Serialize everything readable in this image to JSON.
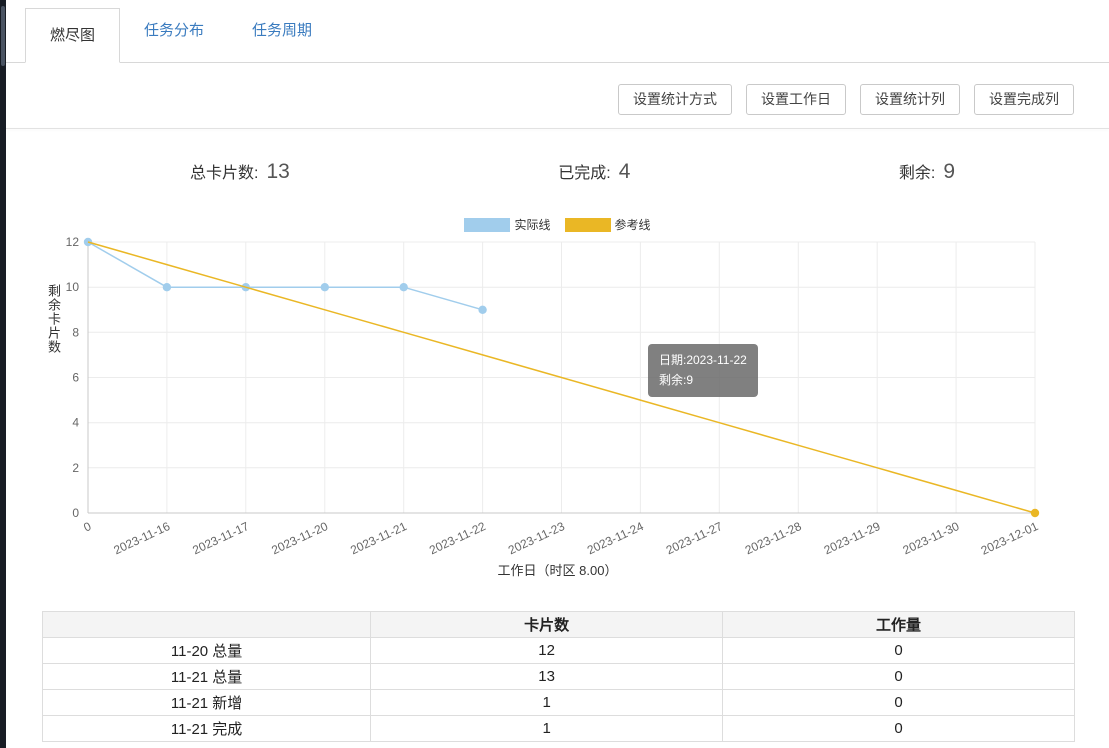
{
  "tabs": [
    {
      "label": "燃尽图",
      "active": true
    },
    {
      "label": "任务分布",
      "active": false
    },
    {
      "label": "任务周期",
      "active": false
    }
  ],
  "toolbar": {
    "buttons": [
      "设置统计方式",
      "设置工作日",
      "设置统计列",
      "设置完成列"
    ]
  },
  "stats": [
    {
      "label": "总卡片数:",
      "value": "13"
    },
    {
      "label": "已完成:",
      "value": "4"
    },
    {
      "label": "剩余:",
      "value": "9"
    }
  ],
  "chart_data": {
    "type": "line",
    "title": "燃尽图",
    "x": [
      "0",
      "2023-11-16",
      "2023-11-17",
      "2023-11-20",
      "2023-11-21",
      "2023-11-22",
      "2023-11-23",
      "2023-11-24",
      "2023-11-27",
      "2023-11-28",
      "2023-11-29",
      "2023-11-30",
      "2023-12-01"
    ],
    "series": [
      {
        "name": "实际线",
        "color": "#a1cdec",
        "markers": "all",
        "values": [
          12,
          10,
          10,
          10,
          10,
          9,
          null,
          null,
          null,
          null,
          null,
          null,
          null
        ]
      },
      {
        "name": "参考线",
        "color": "#eab725",
        "markers": "end",
        "values": [
          12,
          11,
          10,
          9,
          8,
          7,
          6,
          5,
          4,
          3,
          2,
          1,
          0
        ]
      }
    ],
    "ylabel": "剩余卡片数",
    "xlabel": "工作日（时区 8.00）",
    "ylim": [
      0,
      12
    ],
    "yticks": [
      0,
      2,
      4,
      6,
      8,
      10,
      12
    ],
    "grid": true,
    "legend_position": "top"
  },
  "tooltip": {
    "date": "日期:2023-11-22",
    "remaining": "剩余:9"
  },
  "table": {
    "headers": [
      "",
      "卡片数",
      "工作量"
    ],
    "rows": [
      [
        "11-20 总量",
        "12",
        "0"
      ],
      [
        "11-21 总量",
        "13",
        "0"
      ],
      [
        "11-21 新增",
        "1",
        "0"
      ],
      [
        "11-21 完成",
        "1",
        "0"
      ]
    ]
  }
}
